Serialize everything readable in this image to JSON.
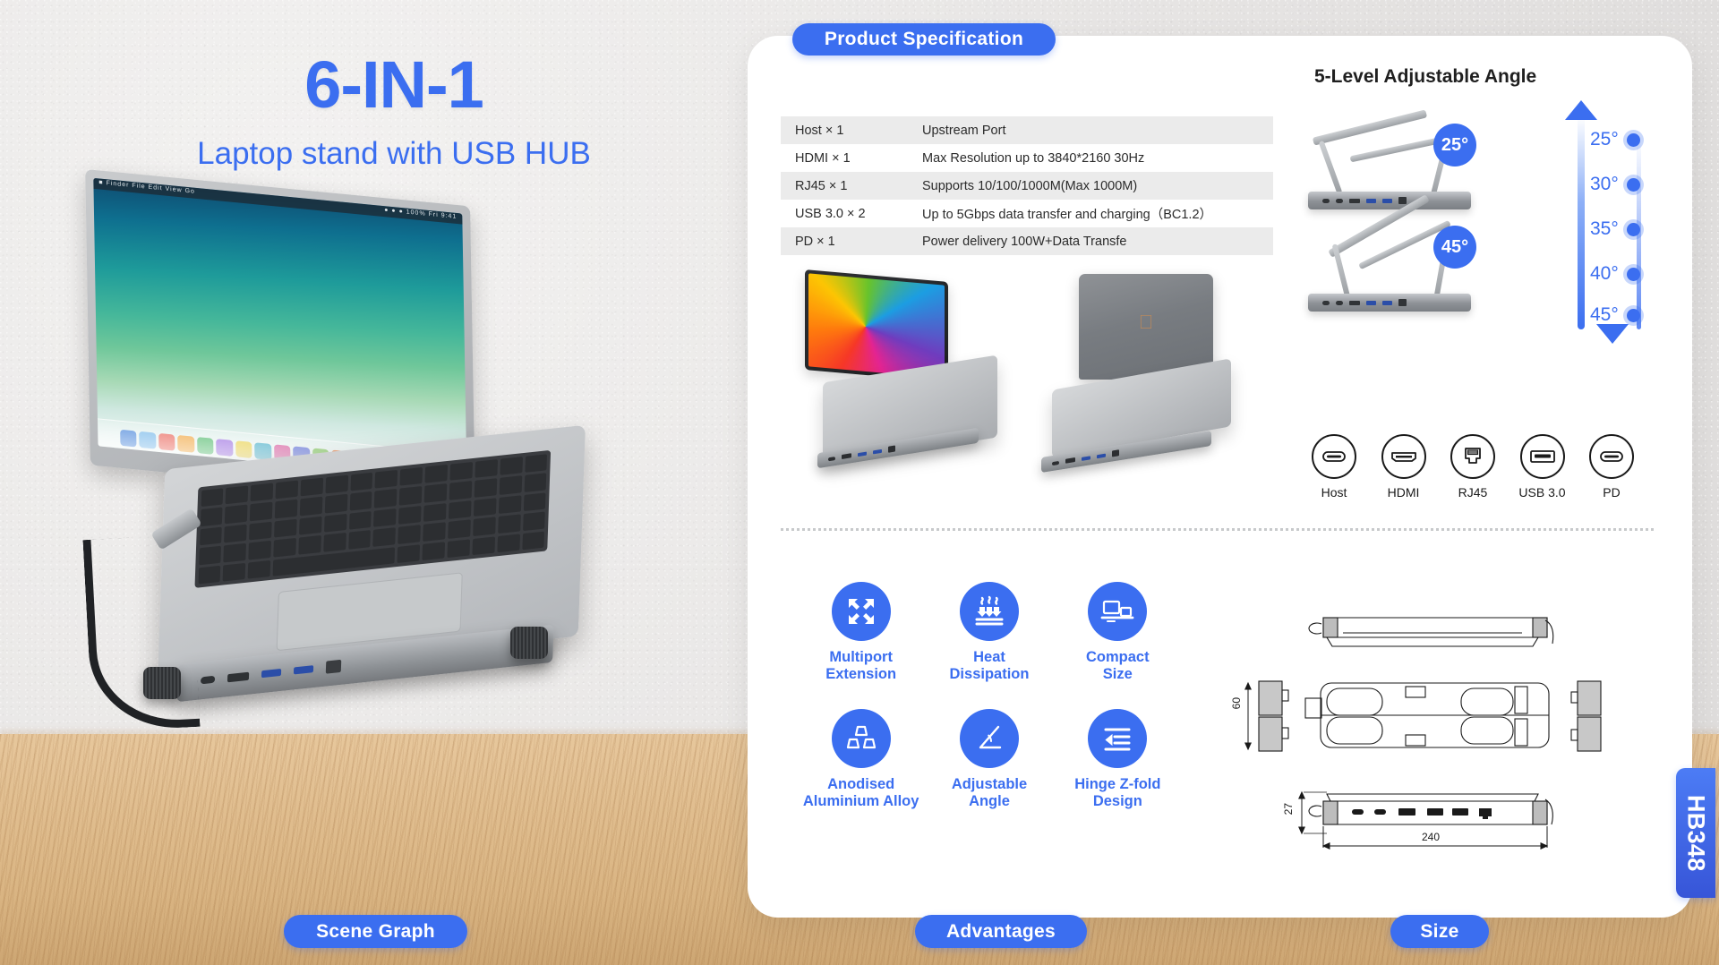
{
  "hero": {
    "title": "6-IN-1",
    "subtitle": "Laptop stand with USB HUB",
    "scene_badge": "Scene Graph"
  },
  "model_badge": "HB348",
  "spec": {
    "badge": "Product Specification",
    "rows": [
      {
        "port": "Host × 1",
        "desc": "Upstream Port"
      },
      {
        "port": "HDMI × 1",
        "desc": "Max Resolution up to 3840*2160 30Hz"
      },
      {
        "port": "RJ45 × 1",
        "desc": "Supports 10/100/1000M(Max 1000M)"
      },
      {
        "port": "USB 3.0 × 2",
        "desc": "Up to 5Gbps data transfer and charging（BC1.2）"
      },
      {
        "port": "PD × 1",
        "desc": "Power delivery 100W+Data Transfe"
      }
    ]
  },
  "angle": {
    "title": "5-Level Adjustable Angle",
    "bubble_top": "25°",
    "bubble_bottom": "45°",
    "levels": [
      "25°",
      "30°",
      "35°",
      "40°",
      "45°"
    ]
  },
  "port_icons": [
    {
      "name": "Host",
      "icon": "usb-c-icon"
    },
    {
      "name": "HDMI",
      "icon": "hdmi-icon"
    },
    {
      "name": "RJ45",
      "icon": "rj45-icon"
    },
    {
      "name": "USB 3.0",
      "icon": "usb-a-icon"
    },
    {
      "name": "PD",
      "icon": "usb-c-icon"
    }
  ],
  "advantages": {
    "badge": "Advantages",
    "items": [
      {
        "label": "Multiport\nExtension",
        "icon": "four-arrows-icon"
      },
      {
        "label": "Heat\nDissipation",
        "icon": "heat-waves-icon"
      },
      {
        "label": "Compact\nSize",
        "icon": "devices-icon"
      },
      {
        "label": "Anodised\nAluminium Alloy",
        "icon": "ingots-icon"
      },
      {
        "label": "Adjustable\nAngle",
        "icon": "protractor-icon"
      },
      {
        "label": "Hinge Z-fold\nDesign",
        "icon": "fold-lines-icon"
      }
    ]
  },
  "size": {
    "badge": "Size",
    "height_mm": "60",
    "thickness_mm": "27",
    "length_mm": "240"
  },
  "colors": {
    "accent": "#3b6ef0",
    "table_alt_row": "#ebebeb",
    "card_bg": "#ffffff",
    "desk": "#e0bd8e",
    "wall": "#e9e7e6"
  }
}
